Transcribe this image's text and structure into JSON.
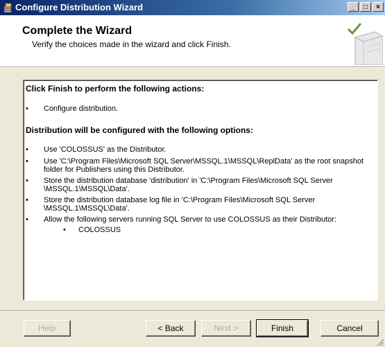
{
  "window": {
    "title": "Configure Distribution Wizard"
  },
  "header": {
    "title": "Complete the Wizard",
    "subtitle": "Verify the choices made in the wizard and click Finish."
  },
  "content": {
    "section1_heading": "Click Finish to perform the following actions:",
    "section1_items": [
      "Configure distribution."
    ],
    "section2_heading": "Distribution will be configured with the following options:",
    "section2_items": [
      "Use 'COLOSSUS' as the Distributor.",
      "Use 'C:\\Program Files\\Microsoft SQL Server\\MSSQL.1\\MSSQL\\ReplData' as the root snapshot folder for Publishers using this Distributor.",
      "Store the distribution database 'distribution' in 'C:\\Program Files\\Microsoft SQL Server \\MSSQL.1\\MSSQL\\Data'.",
      "Store the distribution database log file in 'C:\\Program Files\\Microsoft SQL Server \\MSSQL.1\\MSSQL\\Data'.",
      "Allow the following servers running SQL Server to use COLOSSUS as their Distributor:"
    ],
    "servers": [
      "COLOSSUS"
    ]
  },
  "buttons": {
    "help": "Help",
    "back": "< Back",
    "next": "Next >",
    "finish": "Finish",
    "cancel": "Cancel"
  }
}
